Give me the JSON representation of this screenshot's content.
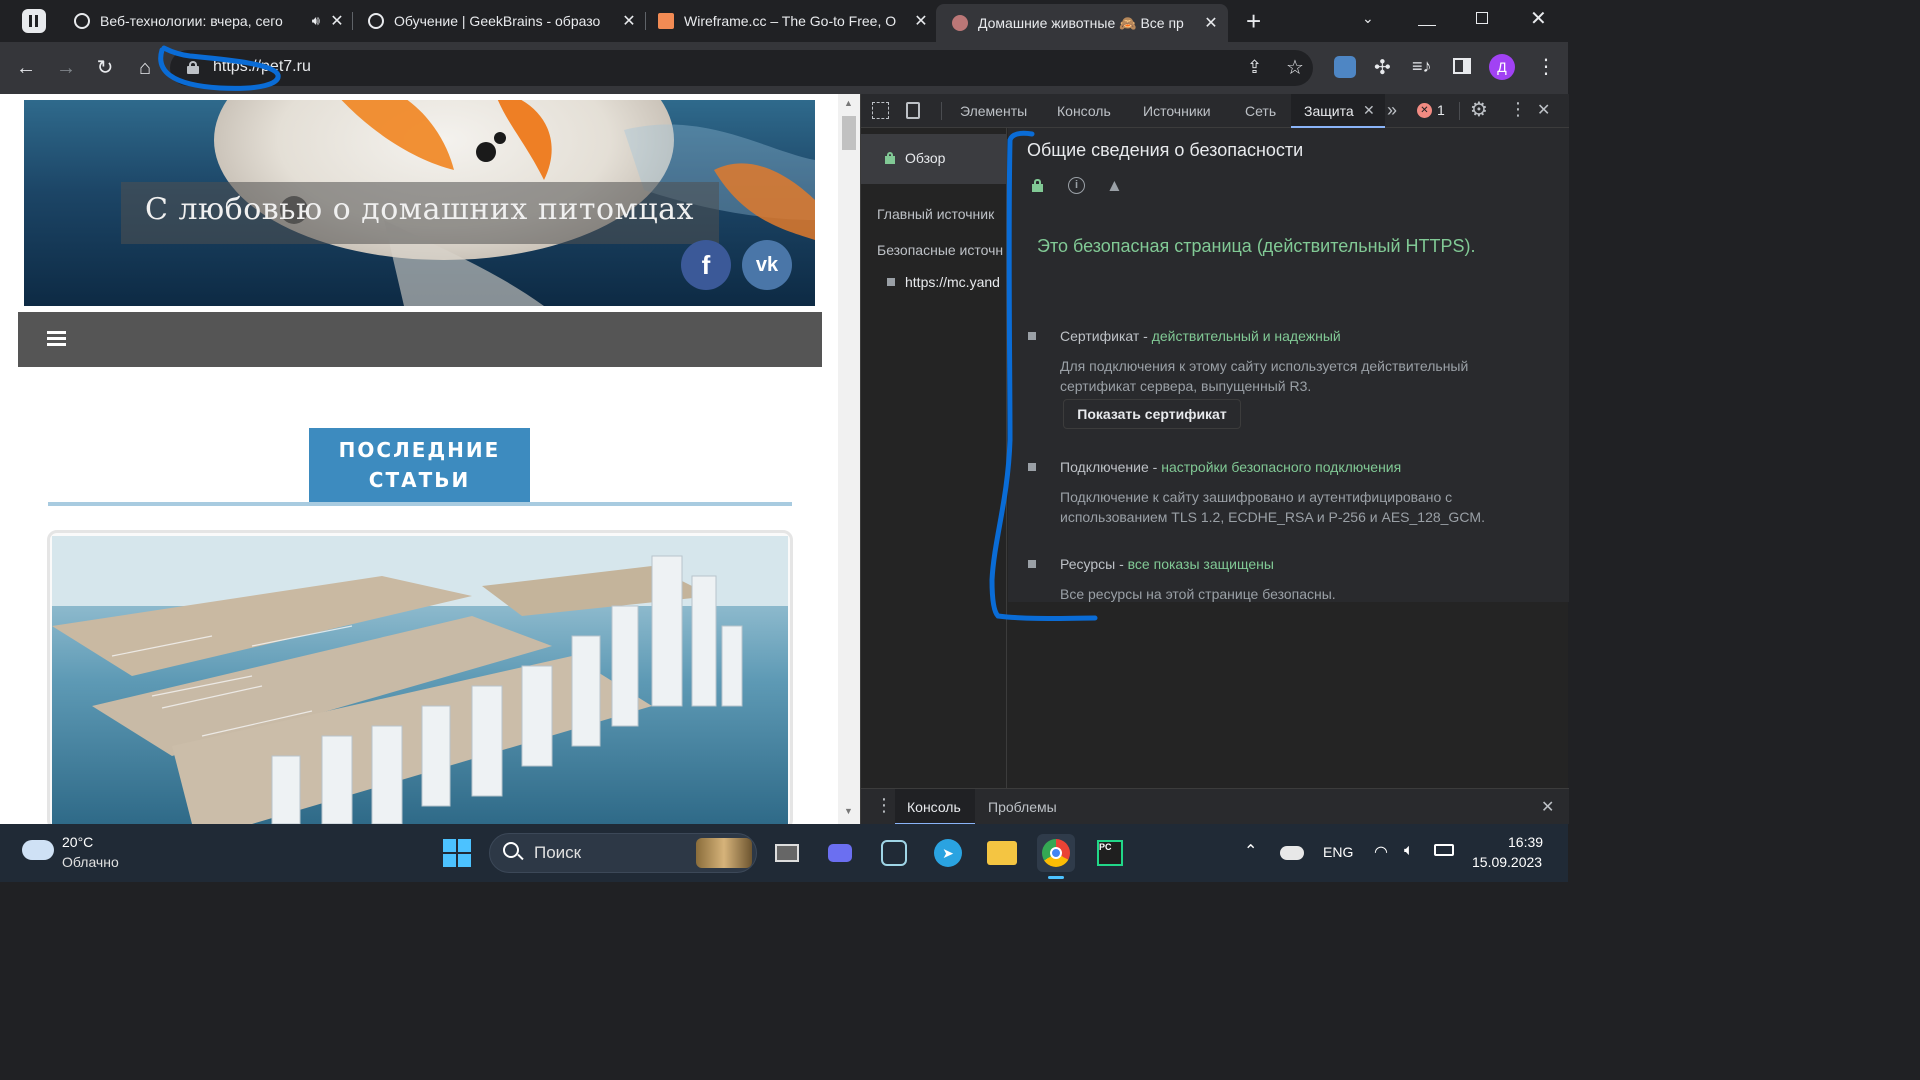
{
  "browser": {
    "tabs": [
      {
        "title": "Веб-технологии: вчера, сего",
        "audio": true
      },
      {
        "title": "Обучение | GeekBrains - образо"
      },
      {
        "title": "Wireframe.cc – The Go-to Free, O"
      },
      {
        "title": "Домашние животные 🙈 Все пр",
        "active": true
      }
    ],
    "new_tab_label": "+",
    "url": "https://pet7.ru",
    "profile_initial": "Д"
  },
  "site": {
    "banner_title": "С любовью о домашних питомцах",
    "social": [
      "f",
      "vk"
    ],
    "section_title_line1": "ПОСЛЕДНИЕ",
    "section_title_line2": "СТАТЬИ"
  },
  "devtools": {
    "tabs": [
      "Элементы",
      "Консоль",
      "Источники",
      "Сеть",
      "Защита"
    ],
    "active_tab": "Защита",
    "error_count": "1",
    "sidebar": {
      "overview": "Обзор",
      "main_origin": "Главный источник",
      "secure_origins": "Безопасные источн",
      "origin_item": "https://mc.yand"
    },
    "security": {
      "heading": "Общие сведения о безопасности",
      "summary": "Это безопасная страница (действительный HTTPS).",
      "cert_label": "Сертификат - ",
      "cert_status": "действительный и надежный",
      "cert_desc1": "Для подключения к этому сайту используется действительный",
      "cert_desc2": "сертификат сервера, выпущенный R3.",
      "cert_button": "Показать сертификат",
      "conn_label": "Подключение - ",
      "conn_status": "настройки безопасного подключения",
      "conn_desc1": "Подключение к сайту зашифровано и аутентифицировано с",
      "conn_desc2": "использованием TLS 1.2, ECDHE_RSA и P-256 и AES_128_GCM.",
      "res_label": "Ресурсы - ",
      "res_status": "все показы защищены",
      "res_desc": "Все ресурсы на этой странице безопасны."
    },
    "drawer_tabs": [
      "Консоль",
      "Проблемы"
    ]
  },
  "taskbar": {
    "weather_temp": "20°C",
    "weather_desc": "Облачно",
    "search_placeholder": "Поиск",
    "lang": "ENG",
    "time": "16:39",
    "date": "15.09.2023"
  },
  "colors": {
    "secure_green": "#81c995",
    "annotation_blue": "#0a6cd6",
    "section_blue": "#3d8bbf",
    "nav_dark": "#555555"
  }
}
